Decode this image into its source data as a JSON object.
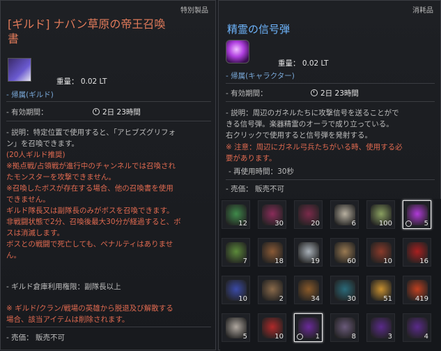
{
  "left": {
    "tag": "特別製品",
    "title": "[ギルド] ナバン草原の帝王召喚書",
    "weight": "重量：  0.02 LT",
    "bind": "- 帰属(ギルド)",
    "period_label": "- 有効期間：",
    "period_value": "2日 23時間",
    "desc": [
      "- 説明：特定位置で使用すると、「アヒブズグリフォ",
      "ン」を召喚できます。"
    ],
    "recommend": "(20人ギルド推奨)",
    "warn": [
      "※拠点戦/占領戦が進行中のチャンネルでは召喚され",
      "たモンスターを攻撃できません。",
      "※召喚したボスが存在する場合、他の召喚書を使用",
      "できません。",
      "ギルド隊長又は副隊長のみがボスを召喚できます。",
      "非戦闘状態で2分、召喚後最大30分が経過すると、ボ",
      "スは消滅します。",
      "ボスとの戦闘で死亡しても、ペナルティはありませ",
      "ん。"
    ],
    "warehouse": "- ギルド倉庫利用権限：副隊長以上",
    "note": [
      "※ ギルド/クラン/戦場の英雄から脱退及び解散する",
      "場合、該当アイテムは削除されます。"
    ],
    "sell": "- 売価：  販売不可"
  },
  "right": {
    "tag": "消耗品",
    "title": "精霊の信号弾",
    "weight": "重量：  0.02 LT",
    "bind": "- 帰属(キャラクター)",
    "period_label": "- 有効期間：",
    "period_value": "2日 23時間",
    "desc": [
      "- 説明：周辺のガネルたちに攻撃信号を送ることがで",
      "きる信号弾。楽器精霊のオーラで成り立っている。",
      "右クリックで使用すると信号弾を発射する。"
    ],
    "warn": [
      "※ 注意：周辺にガネル弓兵たちがいる時、使用する必",
      "要があります。"
    ],
    "reuse": "- 再使用時間：30秒",
    "sell": "- 売価：  販売不可"
  },
  "inventory": [
    {
      "count": "12",
      "color": "#3f8a4a"
    },
    {
      "count": "30",
      "color": "#8a2c5a"
    },
    {
      "count": "20",
      "color": "#7a2a4a"
    },
    {
      "count": "6",
      "color": "#b8b0a0"
    },
    {
      "count": "100",
      "color": "#8aa060"
    },
    {
      "count": "5",
      "color": "#b03ad8",
      "selected": true,
      "timed": true
    },
    {
      "count": "7",
      "color": "#5c8a3a"
    },
    {
      "count": "18",
      "color": "#8a5a36"
    },
    {
      "count": "19",
      "color": "#a8b0b8"
    },
    {
      "count": "60",
      "color": "#9a7a52"
    },
    {
      "count": "10",
      "color": "#8a3a2a"
    },
    {
      "count": "16",
      "color": "#a82020"
    },
    {
      "count": "10",
      "color": "#3a4aa8"
    },
    {
      "count": "2",
      "color": "#8a6a4a"
    },
    {
      "count": "34",
      "color": "#8a5a2a"
    },
    {
      "count": "30",
      "color": "#2a6a7a"
    },
    {
      "count": "51",
      "color": "#c89030"
    },
    {
      "count": "419",
      "color": "#c04020"
    },
    {
      "count": "5",
      "color": "#b0a8a0"
    },
    {
      "count": "10",
      "color": "#b02a2a"
    },
    {
      "count": "1",
      "color": "#6a2a9a",
      "selected": true,
      "timed": true
    },
    {
      "count": "8",
      "color": "#6a5a7a"
    },
    {
      "count": "3",
      "color": "#5a2a8a"
    },
    {
      "count": "4",
      "color": "#5a2a8a"
    }
  ]
}
